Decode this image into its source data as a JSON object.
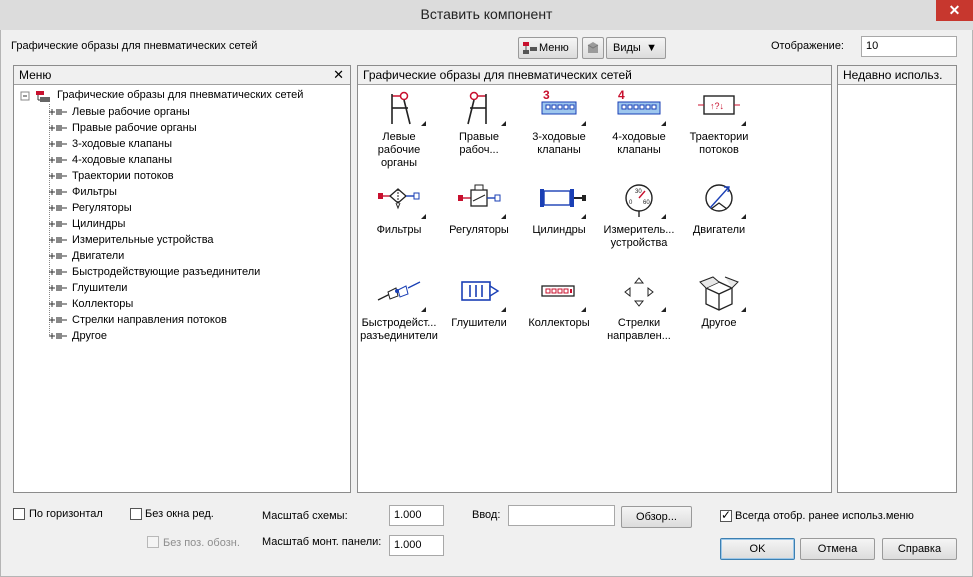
{
  "window": {
    "title": "Вставить компонент",
    "close_glyph": "✕"
  },
  "toolbar": {
    "breadcrumb": "Графические образы для пневматических сетей",
    "menu_btn": "Меню",
    "views_btn": "Виды",
    "display_label": "Отображение:",
    "display_value": "10"
  },
  "left_panel": {
    "header": "Меню",
    "close_glyph": "✕",
    "root_label": "Графические образы для пневматических сетей",
    "items": [
      "Левые рабочие органы",
      "Правые рабочие органы",
      "3-ходовые клапаны",
      "4-ходовые клапаны",
      "Траектории потоков",
      "Фильтры",
      "Регуляторы",
      "Цилиндры",
      "Измерительные устройства",
      "Двигатели",
      "Быстродействующие разъединители",
      "Глушители",
      "Коллекторы",
      "Стрелки направления потоков",
      "Другое"
    ]
  },
  "center_panel": {
    "header": "Графические образы для пневматических сетей",
    "items": [
      {
        "line1": "Левые рабочие",
        "line2": "органы",
        "icon": "left-actuator-icon"
      },
      {
        "line1": "Правые",
        "line2": "рабоч...",
        "icon": "right-actuator-icon"
      },
      {
        "line1": "3-ходовые",
        "line2": "клапаны",
        "icon": "valve-3-way-icon",
        "badge": "3"
      },
      {
        "line1": "4-ходовые",
        "line2": "клапаны",
        "icon": "valve-4-way-icon",
        "badge": "4"
      },
      {
        "line1": "Траектории",
        "line2": "потоков",
        "icon": "flow-path-icon"
      },
      {
        "line1": "Фильтры",
        "line2": "",
        "icon": "filter-icon"
      },
      {
        "line1": "Регуляторы",
        "line2": "",
        "icon": "regulator-icon"
      },
      {
        "line1": "Цилиндры",
        "line2": "",
        "icon": "cylinder-icon"
      },
      {
        "line1": "Измеритель...",
        "line2": "устройства",
        "icon": "gauge-icon"
      },
      {
        "line1": "Двигатели",
        "line2": "",
        "icon": "motor-icon"
      },
      {
        "line1": "Быстродейст...",
        "line2": "разъединители",
        "icon": "quick-coupler-icon"
      },
      {
        "line1": "Глушители",
        "line2": "",
        "icon": "silencer-icon"
      },
      {
        "line1": "Коллекторы",
        "line2": "",
        "icon": "manifold-icon"
      },
      {
        "line1": "Стрелки",
        "line2": "направлен...",
        "icon": "flow-arrows-icon"
      },
      {
        "line1": "Другое",
        "line2": "",
        "icon": "other-box-icon"
      }
    ]
  },
  "right_panel": {
    "header": "Недавно использ."
  },
  "bottom": {
    "horizontal_label": "По горизонтал",
    "no_edit_window_label": "Без окна ред.",
    "no_pos_label": "Без поз. обозн.",
    "scheme_scale_label": "Масштаб схемы:",
    "scheme_scale_value": "1.000",
    "panel_scale_label": "Масштаб монт. панели:",
    "panel_scale_value": "1.000",
    "input_label": "Ввод:",
    "input_value": "",
    "browse_btn": "Обзор...",
    "always_show_label": "Всегда отобр. ранее использ.меню",
    "ok_btn": "OK",
    "cancel_btn": "Отмена",
    "help_btn": "Справка"
  },
  "colors": {
    "accent_red": "#c8102e",
    "accent_blue": "#1a3fb5",
    "title_close": "#c7372e"
  }
}
